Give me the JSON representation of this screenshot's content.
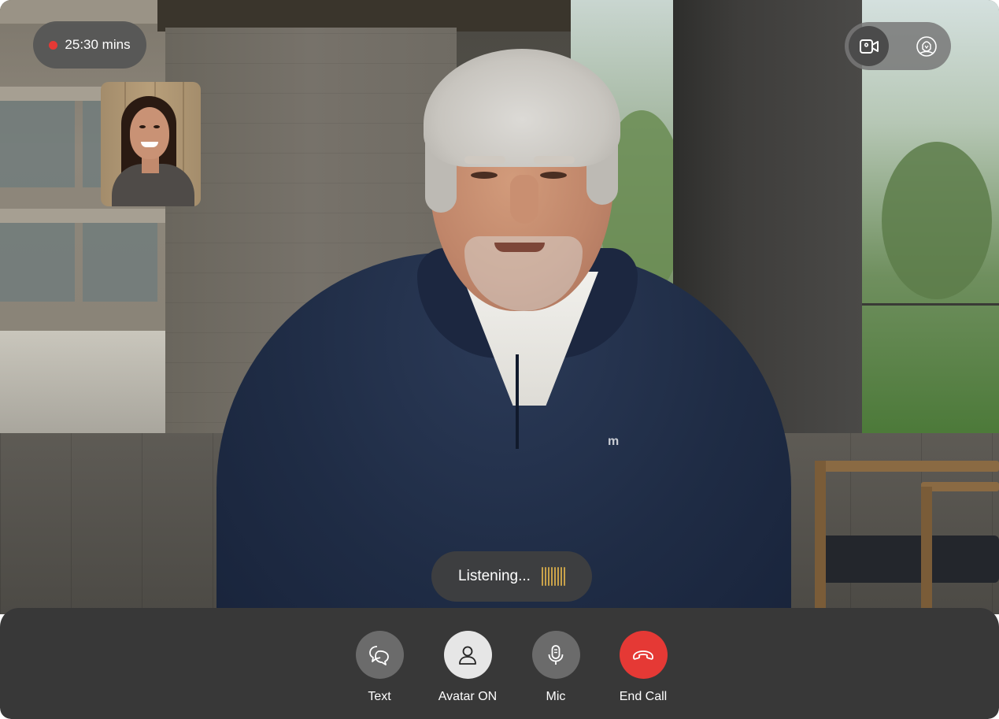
{
  "call": {
    "timer_text": "25:30 mins",
    "status_text": "Listening...",
    "recording_indicator_color": "#e53935"
  },
  "view_toggle": {
    "options": [
      {
        "name": "video",
        "icon": "video-camera-icon",
        "active": true
      },
      {
        "name": "avatar",
        "icon": "avatar-face-icon",
        "active": false
      }
    ]
  },
  "controls": {
    "text": {
      "label": "Text",
      "icon": "chat-bubbles-icon"
    },
    "avatar": {
      "label": "Avatar ON",
      "icon": "person-icon"
    },
    "mic": {
      "label": "Mic",
      "icon": "microphone-icon"
    },
    "end_call": {
      "label": "End Call",
      "icon": "hang-up-phone-icon",
      "color": "#e53935"
    }
  },
  "theme": {
    "control_bar_bg": "#383838",
    "accent_listening_bars": "#c9a24a"
  }
}
